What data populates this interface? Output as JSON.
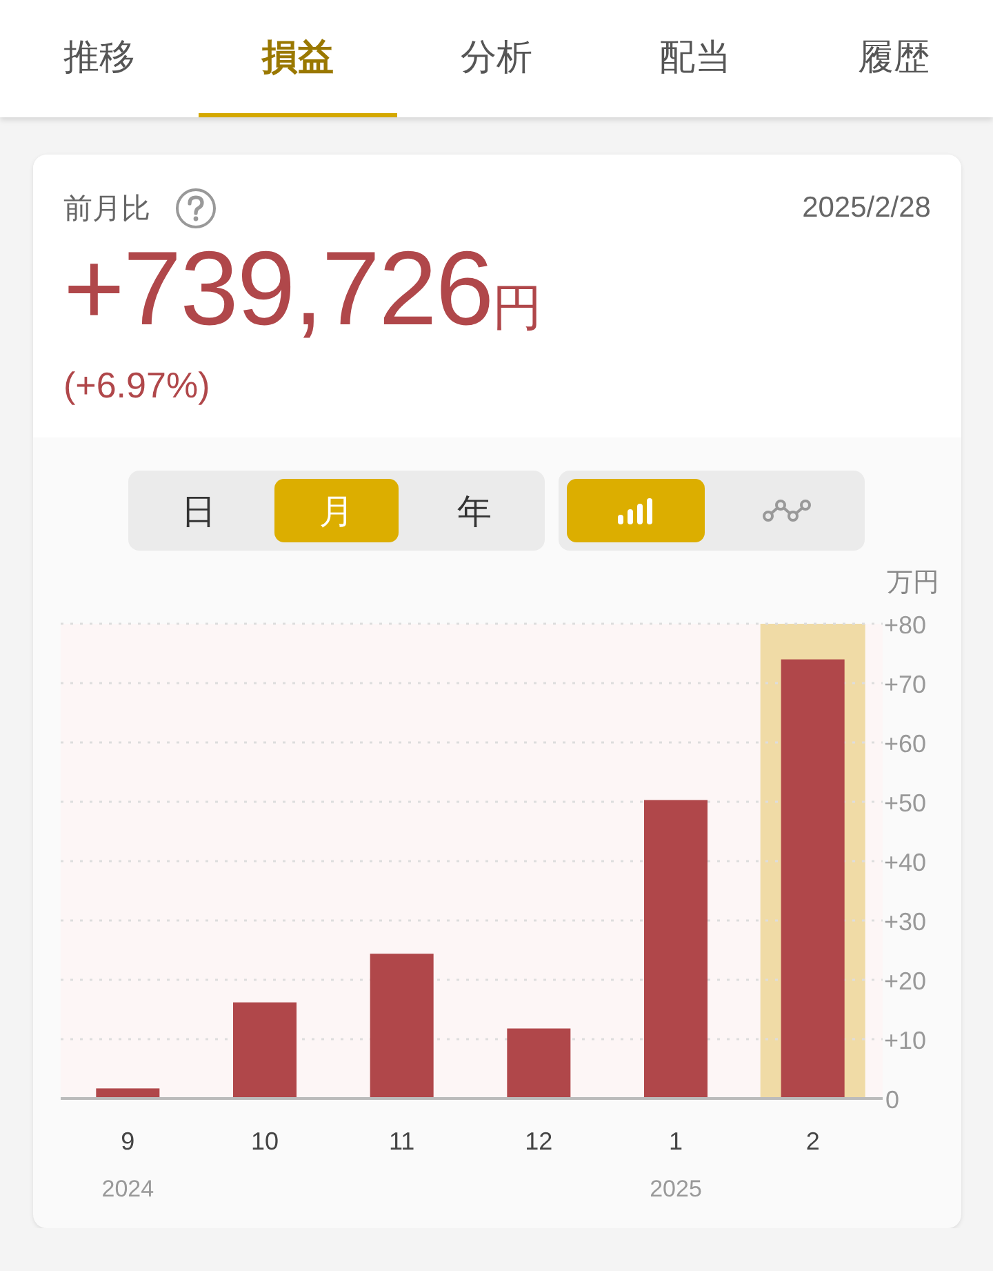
{
  "tabs": [
    {
      "label": "推移",
      "selected": false
    },
    {
      "label": "損益",
      "selected": true
    },
    {
      "label": "分析",
      "selected": false
    },
    {
      "label": "配当",
      "selected": false
    },
    {
      "label": "履歴",
      "selected": false
    }
  ],
  "summary": {
    "label": "前月比",
    "date": "2025/2/28",
    "amount": "+739,726",
    "unit": "円",
    "percent": "(+6.97%)"
  },
  "period_options": [
    {
      "label": "日",
      "selected": false
    },
    {
      "label": "月",
      "selected": true
    },
    {
      "label": "年",
      "selected": false
    }
  ],
  "chart_types": [
    {
      "kind": "bar",
      "selected": true
    },
    {
      "kind": "line",
      "selected": false
    }
  ],
  "chart": {
    "chart_data": {
      "type": "bar",
      "ylabel": "万円",
      "categories": [
        "9",
        "10",
        "11",
        "12",
        "1",
        "2"
      ],
      "series": [
        {
          "color": "#b0474a",
          "values": [
            1.7,
            16.2,
            24.4,
            11.8,
            50.3,
            74.0
          ]
        }
      ],
      "ylim": [
        0,
        80
      ],
      "yticks": [
        {
          "value": 0,
          "label": "0"
        },
        {
          "value": 10,
          "label": "+10"
        },
        {
          "value": 20,
          "label": "+20"
        },
        {
          "value": 30,
          "label": "+30"
        },
        {
          "value": 40,
          "label": "+40"
        },
        {
          "value": 50,
          "label": "+50"
        },
        {
          "value": 60,
          "label": "+60"
        },
        {
          "value": 70,
          "label": "+70"
        },
        {
          "value": 80,
          "label": "+80"
        }
      ],
      "grid": true
    },
    "bars": [
      {
        "selected": false,
        "year": "2024"
      },
      {
        "selected": false
      },
      {
        "selected": false
      },
      {
        "selected": false
      },
      {
        "selected": false,
        "year": "2025"
      },
      {
        "selected": true
      }
    ]
  }
}
